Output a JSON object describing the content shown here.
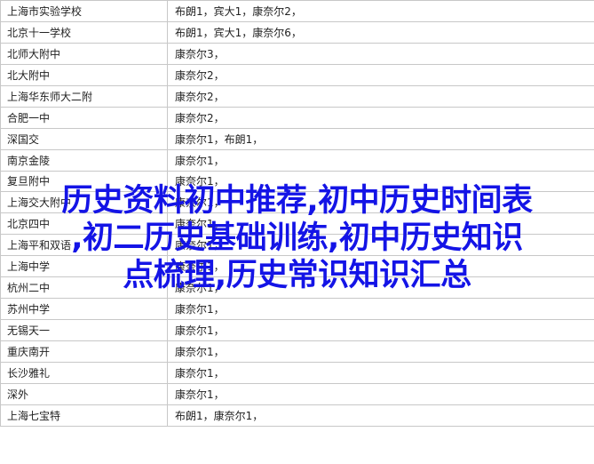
{
  "table": {
    "rows": [
      {
        "school": "上海市实验学校",
        "winners": "布朗1，宾大1，康奈尔2，"
      },
      {
        "school": "北京十一学校",
        "winners": "布朗1，宾大1，康奈尔6，"
      },
      {
        "school": "北师大附中",
        "winners": "康奈尔3，"
      },
      {
        "school": "北大附中",
        "winners": "康奈尔2，"
      },
      {
        "school": "上海华东师大二附",
        "winners": "康奈尔2，"
      },
      {
        "school": "合肥一中",
        "winners": "康奈尔2，"
      },
      {
        "school": "深国交",
        "winners": "康奈尔1，布朗1，"
      },
      {
        "school": "南京金陵",
        "winners": "康奈尔1，"
      },
      {
        "school": "复旦附中",
        "winners": "康奈尔1，"
      },
      {
        "school": "上海交大附中",
        "winners": "康奈尔1，"
      },
      {
        "school": "北京四中",
        "winners": "康奈尔1，"
      },
      {
        "school": "上海平和双语",
        "winners": "康奈尔1，"
      },
      {
        "school": "上海中学",
        "winners": "康奈尔1，"
      },
      {
        "school": "杭州二中",
        "winners": "康奈尔1，"
      },
      {
        "school": "苏州中学",
        "winners": "康奈尔1，"
      },
      {
        "school": "无锡天一",
        "winners": "康奈尔1，"
      },
      {
        "school": "重庆南开",
        "winners": "康奈尔1，"
      },
      {
        "school": "长沙雅礼",
        "winners": "康奈尔1，"
      },
      {
        "school": "深外",
        "winners": "康奈尔1，"
      },
      {
        "school": "上海七宝特",
        "winners": "布朗1，康奈尔1，"
      }
    ]
  },
  "headline": {
    "line1": "历史资料初中推荐,初中历史时间表",
    "line2": ",初二历史基础训练,初中历史知识",
    "line3": "点梳理,历史常识知识汇总"
  }
}
